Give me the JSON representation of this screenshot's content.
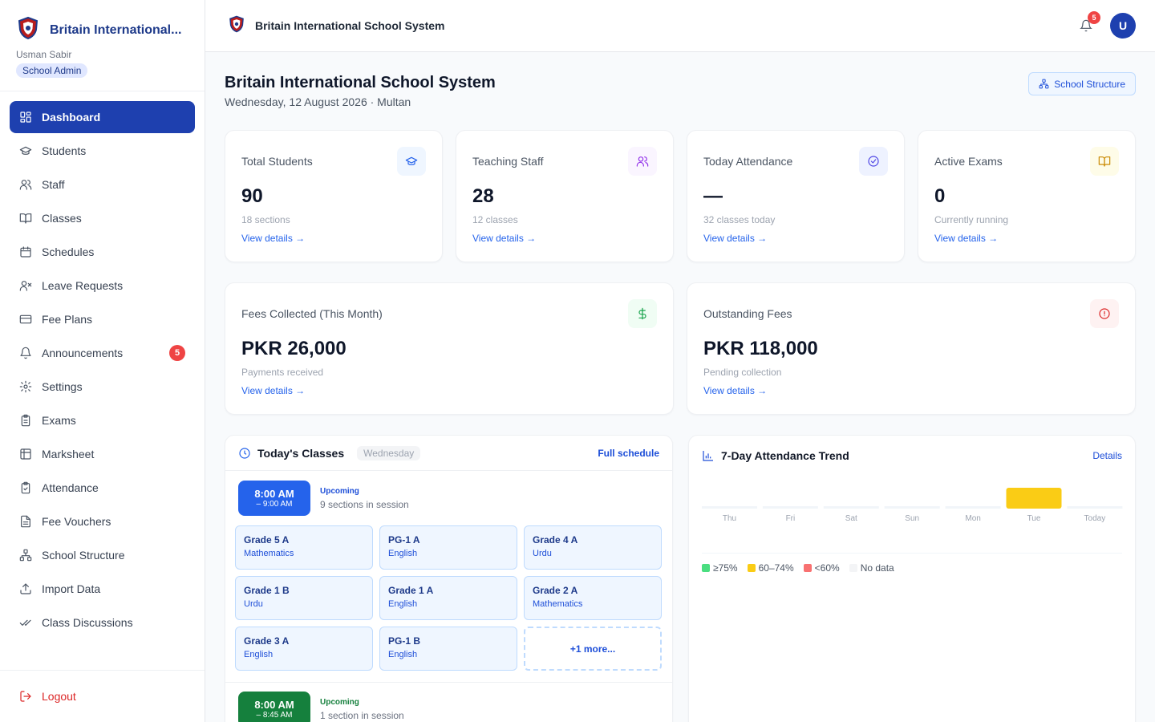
{
  "brand": {
    "name": "Britain International...",
    "user": "Usman Sabir",
    "role": "School Admin"
  },
  "sidebar": {
    "items": [
      {
        "label": "Dashboard",
        "icon": "dashboard-icon",
        "active": true
      },
      {
        "label": "Students",
        "icon": "graduation-cap-icon"
      },
      {
        "label": "Staff",
        "icon": "users-icon"
      },
      {
        "label": "Classes",
        "icon": "book-open-icon"
      },
      {
        "label": "Schedules",
        "icon": "calendar-icon"
      },
      {
        "label": "Leave Requests",
        "icon": "user-x-icon"
      },
      {
        "label": "Fee Plans",
        "icon": "credit-card-icon"
      },
      {
        "label": "Announcements",
        "icon": "bell-icon",
        "badge": "5"
      },
      {
        "label": "Settings",
        "icon": "gear-icon"
      },
      {
        "label": "Exams",
        "icon": "clipboard-icon"
      },
      {
        "label": "Marksheet",
        "icon": "table-icon"
      },
      {
        "label": "Attendance",
        "icon": "clipboard-check-icon"
      },
      {
        "label": "Fee Vouchers",
        "icon": "file-text-icon"
      },
      {
        "label": "School Structure",
        "icon": "network-icon"
      },
      {
        "label": "Import Data",
        "icon": "upload-icon"
      },
      {
        "label": "Class Discussions",
        "icon": "check-check-icon"
      }
    ],
    "logout": "Logout"
  },
  "topbar": {
    "title": "Britain International School System",
    "notification_count": "5",
    "avatar_initial": "U"
  },
  "page": {
    "title": "Britain International School System",
    "subtitle": "Wednesday, 12 August 2026 · Multan",
    "structure_button": "School Structure"
  },
  "stats": [
    {
      "label": "Total Students",
      "value": "90",
      "sub": "18 sections",
      "link": "View details →",
      "icon": "graduation-cap-icon",
      "color": "#2563eb",
      "bg": "#eff6ff"
    },
    {
      "label": "Teaching Staff",
      "value": "28",
      "sub": "12 classes",
      "link": "View details →",
      "icon": "users-icon",
      "color": "#9333ea",
      "bg": "#faf5ff"
    },
    {
      "label": "Today Attendance",
      "value": "—",
      "sub": "32 classes today",
      "link": "View details →",
      "icon": "check-circle-icon",
      "color": "#4f46e5",
      "bg": "#eef2ff"
    },
    {
      "label": "Active Exams",
      "value": "0",
      "sub": "Currently running",
      "link": "View details →",
      "icon": "book-open-icon",
      "color": "#ca8a04",
      "bg": "#fefce8"
    }
  ],
  "fees": [
    {
      "label": "Fees Collected (This Month)",
      "value": "PKR 26,000",
      "sub": "Payments received",
      "link": "View details →",
      "icon": "dollar-icon",
      "color": "#16a34a",
      "bg": "#f0fdf4"
    },
    {
      "label": "Outstanding Fees",
      "value": "PKR 118,000",
      "sub": "Pending collection",
      "link": "View details →",
      "icon": "alert-circle-icon",
      "color": "#dc2626",
      "bg": "#fef2f2"
    }
  ],
  "todays_classes": {
    "title": "Today's Classes",
    "day": "Wednesday",
    "link": "Full schedule",
    "slots": [
      {
        "time": "8:00 AM",
        "end": "– 9:00 AM",
        "status": "Upcoming",
        "desc": "9 sections in session",
        "color": "#2563eb",
        "classes": [
          {
            "name": "Grade 5 A",
            "subject": "Mathematics"
          },
          {
            "name": "PG-1 A",
            "subject": "English"
          },
          {
            "name": "Grade 4 A",
            "subject": "Urdu"
          },
          {
            "name": "Grade 1 B",
            "subject": "Urdu"
          },
          {
            "name": "Grade 1 A",
            "subject": "English"
          },
          {
            "name": "Grade 2 A",
            "subject": "Mathematics"
          },
          {
            "name": "Grade 3 A",
            "subject": "English"
          },
          {
            "name": "PG-1 B",
            "subject": "English"
          }
        ],
        "more": "+1 more..."
      },
      {
        "time": "8:00 AM",
        "end": "– 8:45 AM",
        "status": "Upcoming",
        "desc": "1 section in session",
        "color": "#15803d"
      }
    ]
  },
  "trend": {
    "title": "7-Day Attendance Trend",
    "link": "Details",
    "legend": [
      {
        "label": "≥75%",
        "color": "#4ade80"
      },
      {
        "label": "60–74%",
        "color": "#facc15"
      },
      {
        "label": "<60%",
        "color": "#f87171"
      },
      {
        "label": "No data",
        "color": "#f3f4f6"
      }
    ]
  },
  "chart_data": {
    "type": "bar",
    "title": "7-Day Attendance Trend",
    "categories": [
      "Thu",
      "Fri",
      "Sat",
      "Sun",
      "Mon",
      "Tue",
      "Today"
    ],
    "values": [
      null,
      null,
      null,
      null,
      null,
      65,
      null
    ],
    "bands": [
      "none",
      "none",
      "none",
      "none",
      "none",
      "60–74%",
      "none"
    ],
    "ylim": [
      0,
      100
    ],
    "grid": false,
    "legend_placement": "bottom-left"
  }
}
